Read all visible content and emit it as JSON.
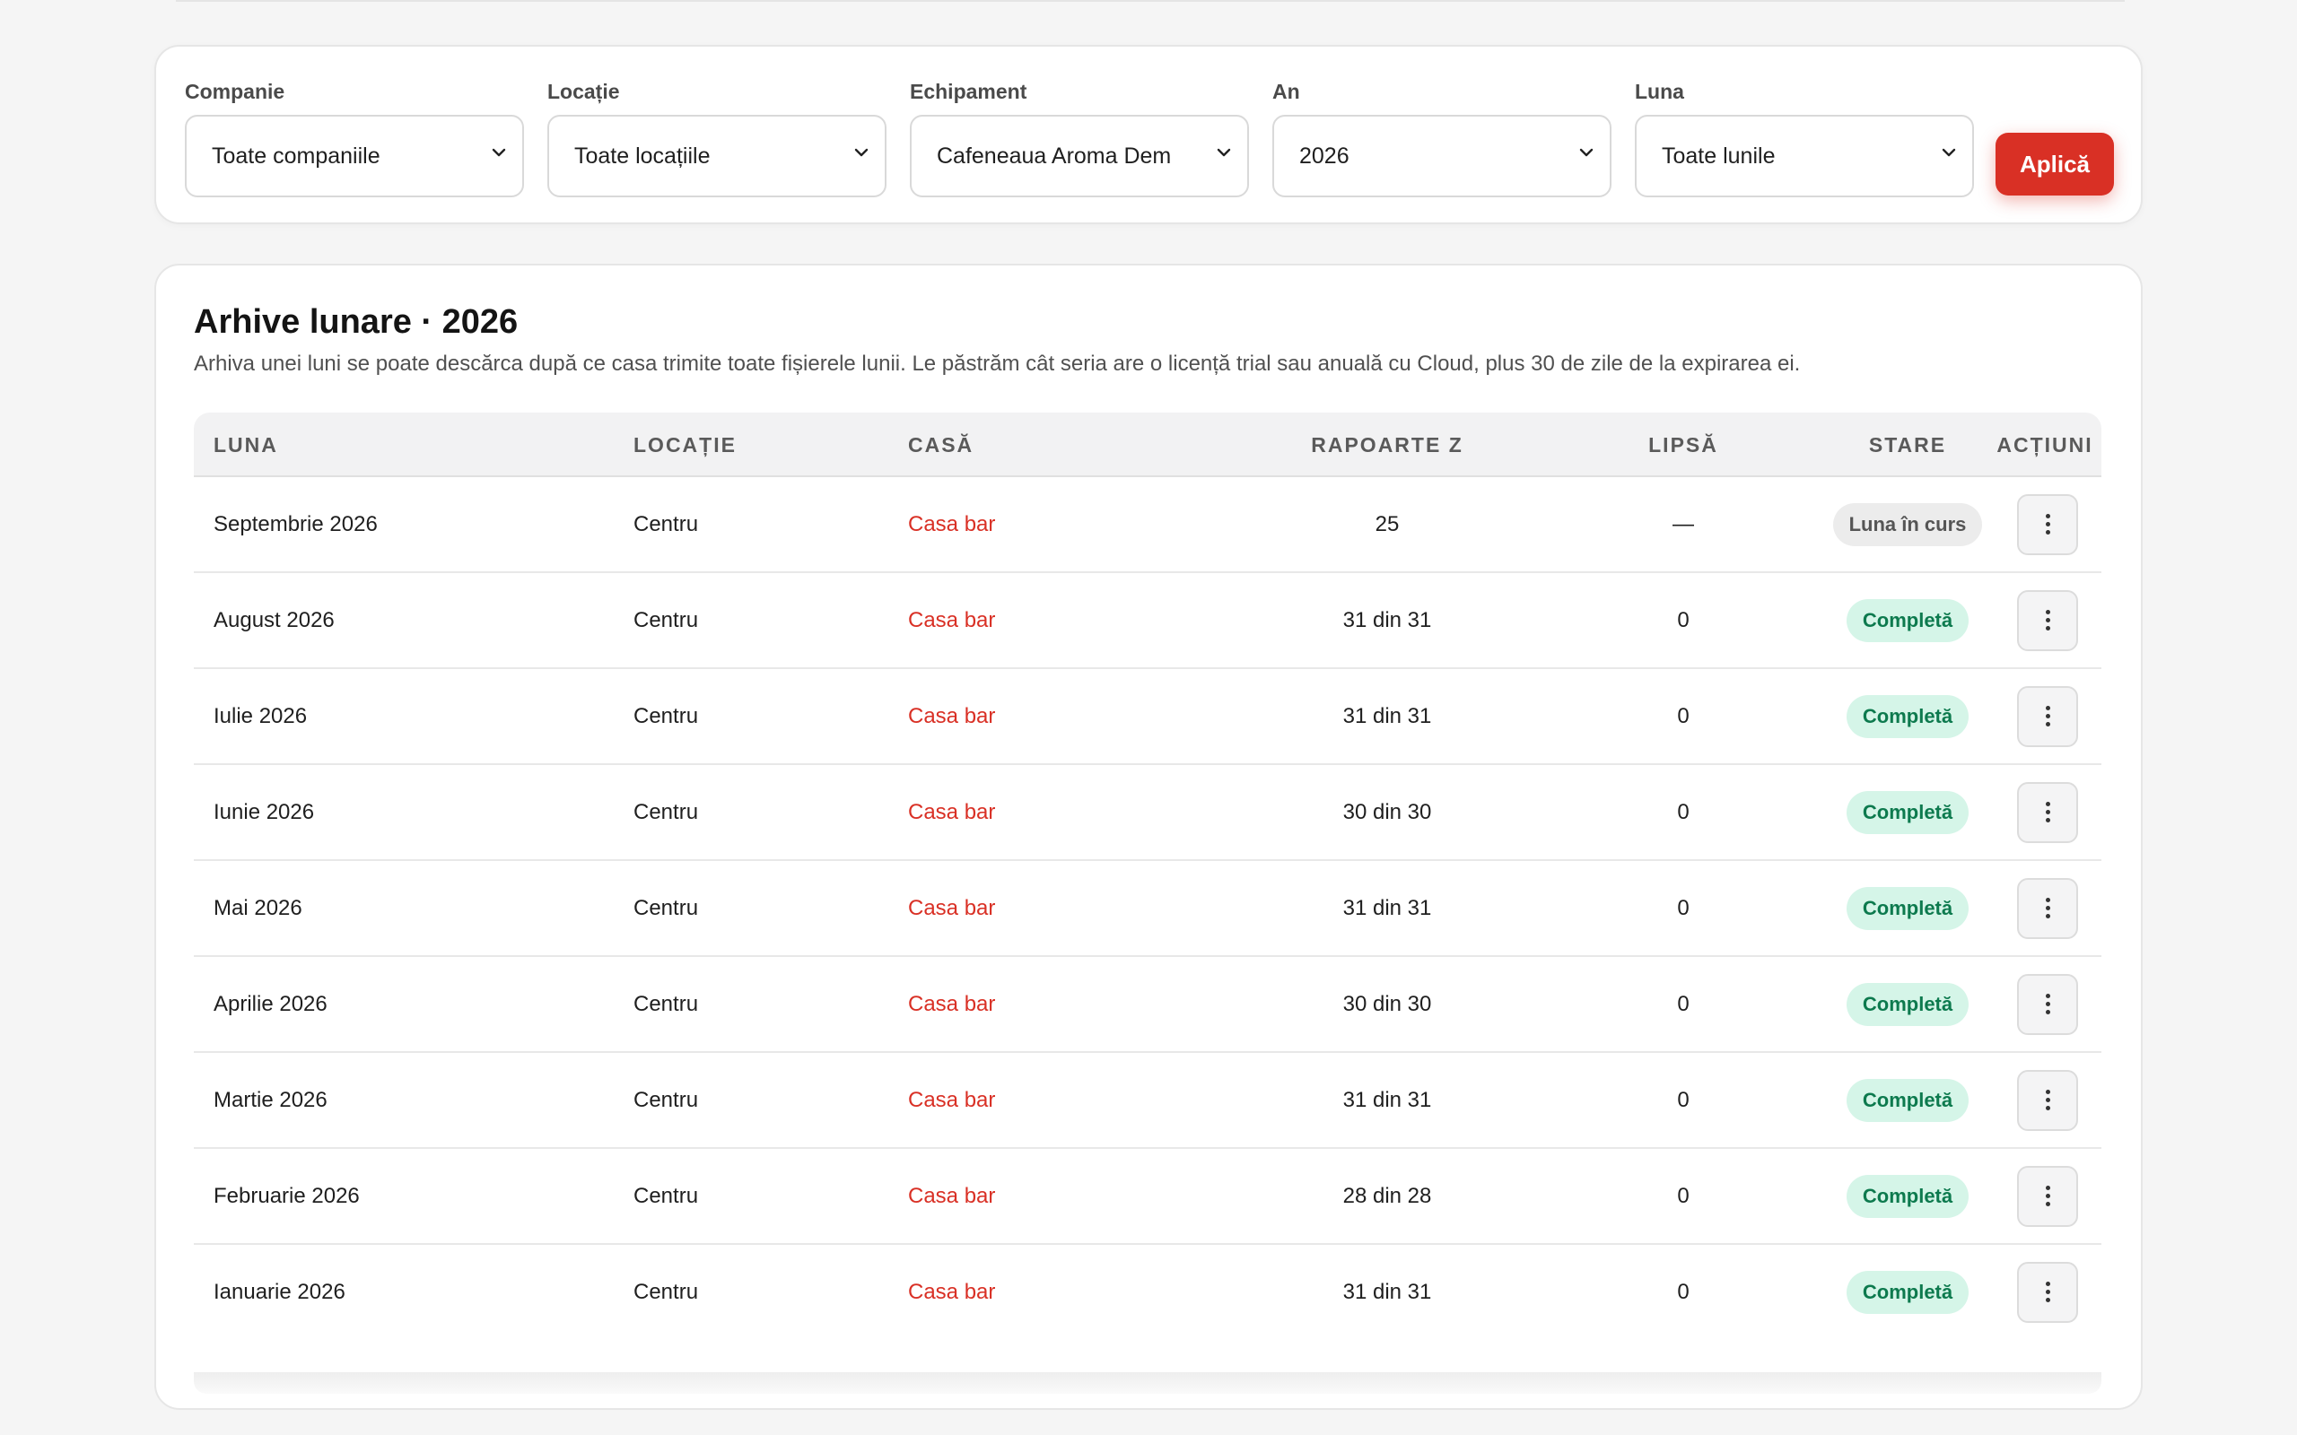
{
  "filters": {
    "company": {
      "label": "Companie",
      "value": "Toate companiile"
    },
    "location": {
      "label": "Locație",
      "value": "Toate locațiile"
    },
    "equipment": {
      "label": "Echipament",
      "value": "Cafeneaua Aroma Dem"
    },
    "year": {
      "label": "An",
      "value": "2026"
    },
    "month": {
      "label": "Luna",
      "value": "Toate lunile"
    },
    "apply_label": "Aplică"
  },
  "archive": {
    "title": "Arhive lunare · 2026",
    "description": "Arhiva unei luni se poate descărca după ce casa trimite toate fișierele lunii. Le păstrăm cât seria are o licență trial sau anuală cu Cloud, plus 30 de zile de la expirarea ei.",
    "columns": {
      "luna": "LUNA",
      "locatie": "LOCAȚIE",
      "casa": "CASĂ",
      "rapoarte": "RAPOARTE Z",
      "lipsa": "LIPSĂ",
      "stare": "STARE",
      "actiuni": "ACȚIUNI"
    },
    "rows": [
      {
        "luna": "Septembrie 2026",
        "locatie": "Centru",
        "casa": "Casa bar",
        "rapoarte": "25",
        "lipsa": "—",
        "stare": "Luna în curs",
        "status": "current"
      },
      {
        "luna": "August 2026",
        "locatie": "Centru",
        "casa": "Casa bar",
        "rapoarte": "31 din 31",
        "lipsa": "0",
        "stare": "Completă",
        "status": "complete"
      },
      {
        "luna": "Iulie 2026",
        "locatie": "Centru",
        "casa": "Casa bar",
        "rapoarte": "31 din 31",
        "lipsa": "0",
        "stare": "Completă",
        "status": "complete"
      },
      {
        "luna": "Iunie 2026",
        "locatie": "Centru",
        "casa": "Casa bar",
        "rapoarte": "30 din 30",
        "lipsa": "0",
        "stare": "Completă",
        "status": "complete"
      },
      {
        "luna": "Mai 2026",
        "locatie": "Centru",
        "casa": "Casa bar",
        "rapoarte": "31 din 31",
        "lipsa": "0",
        "stare": "Completă",
        "status": "complete"
      },
      {
        "luna": "Aprilie 2026",
        "locatie": "Centru",
        "casa": "Casa bar",
        "rapoarte": "30 din 30",
        "lipsa": "0",
        "stare": "Completă",
        "status": "complete"
      },
      {
        "luna": "Martie 2026",
        "locatie": "Centru",
        "casa": "Casa bar",
        "rapoarte": "31 din 31",
        "lipsa": "0",
        "stare": "Completă",
        "status": "complete"
      },
      {
        "luna": "Februarie 2026",
        "locatie": "Centru",
        "casa": "Casa bar",
        "rapoarte": "28 din 28",
        "lipsa": "0",
        "stare": "Completă",
        "status": "complete"
      },
      {
        "luna": "Ianuarie 2026",
        "locatie": "Centru",
        "casa": "Casa bar",
        "rapoarte": "31 din 31",
        "lipsa": "0",
        "stare": "Completă",
        "status": "complete"
      }
    ]
  },
  "colors": {
    "accent": "#d93025",
    "complete_bg": "#d5f5e8",
    "complete_text": "#0d7a4e"
  },
  "icons": {
    "select_arrow": "chevron-down-icon",
    "row_actions": "kebab-menu-icon"
  }
}
